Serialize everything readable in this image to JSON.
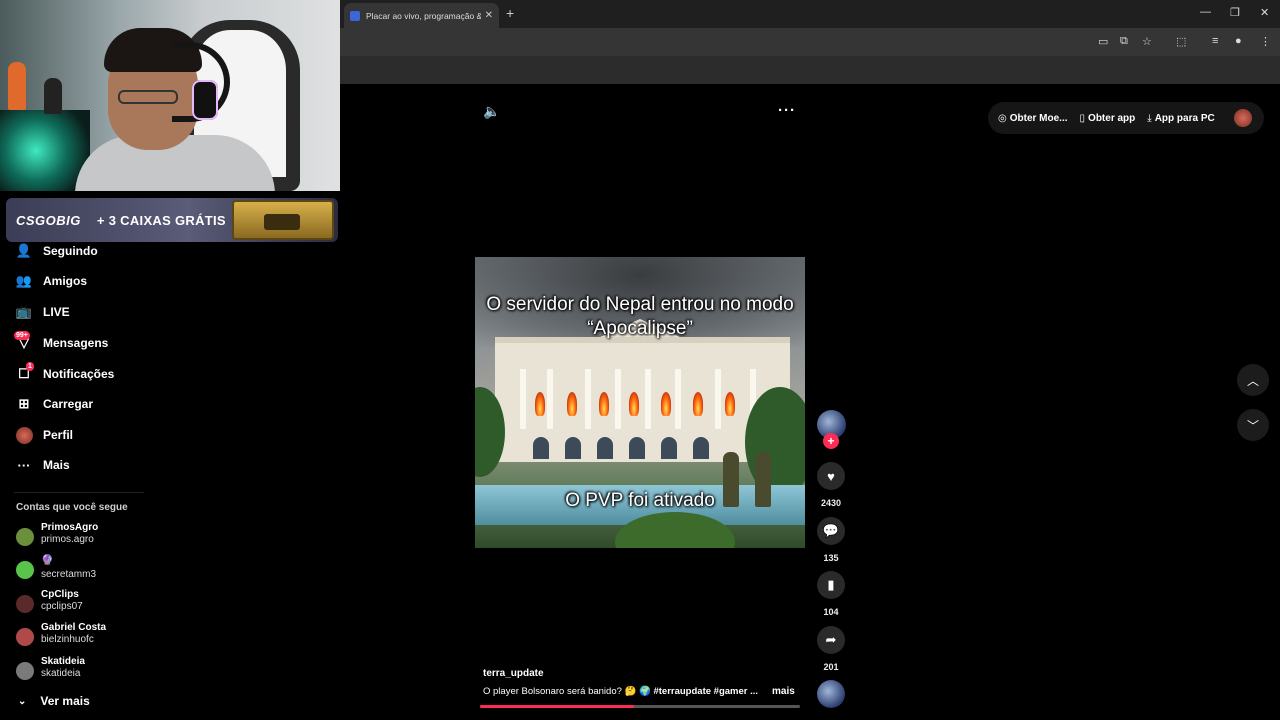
{
  "browser": {
    "tab_title": "Placar ao vivo, programação &",
    "tab_close": "✕",
    "new_tab": "+",
    "window_controls": [
      "—",
      "❐",
      "✕"
    ]
  },
  "stream_overlay": {
    "ad_logo": "CSGOBIG",
    "ad_offer": "+ 3 CAIXAS GRÁTIS"
  },
  "nav": {
    "items": [
      {
        "label": "Seguindo",
        "icon": "following-icon"
      },
      {
        "label": "Amigos",
        "icon": "friends-icon"
      },
      {
        "label": "LIVE",
        "icon": "live-icon"
      },
      {
        "label": "Mensagens",
        "icon": "messages-icon",
        "badge": "99+"
      },
      {
        "label": "Notificações",
        "icon": "notifications-icon",
        "badge": "1"
      },
      {
        "label": "Carregar",
        "icon": "upload-icon"
      },
      {
        "label": "Perfil",
        "icon": "profile-avatar"
      },
      {
        "label": "Mais",
        "icon": "more-icon"
      }
    ],
    "following_title": "Contas que você segue",
    "accounts": [
      {
        "name": "PrimosAgro",
        "handle": "primos.agro",
        "color": "#6b8f3a"
      },
      {
        "name": "",
        "handle": "secretamm3",
        "color": "#58c44a"
      },
      {
        "name": "CpClips",
        "handle": "cpclips07",
        "color": "#5a2a2a"
      },
      {
        "name": "Gabriel Costa",
        "handle": "bielzinhuofc",
        "color": "#b04a4a"
      },
      {
        "name": "Skatideia",
        "handle": "skatideia",
        "color": "#7a7a7a"
      }
    ],
    "see_more": "Ver mais"
  },
  "top_bar": {
    "coins": "Obter Moe...",
    "get_app": "Obter app",
    "pc_app": "App para PC"
  },
  "video": {
    "caption_top": "O servidor do Nepal entrou no modo “Apocalipse”",
    "caption_bottom": "O PVP foi ativado",
    "author": "terra_update",
    "description": "O player Bolsonaro será banido? 🤔 🌍",
    "hashtags": "#terraupdate  #gamer ...",
    "more": "mais",
    "progress": 0.48
  },
  "actions": {
    "likes": "2430",
    "comments": "135",
    "saves": "104",
    "shares": "201"
  },
  "colors": {
    "accent": "#fe2c55",
    "background": "#000000"
  }
}
